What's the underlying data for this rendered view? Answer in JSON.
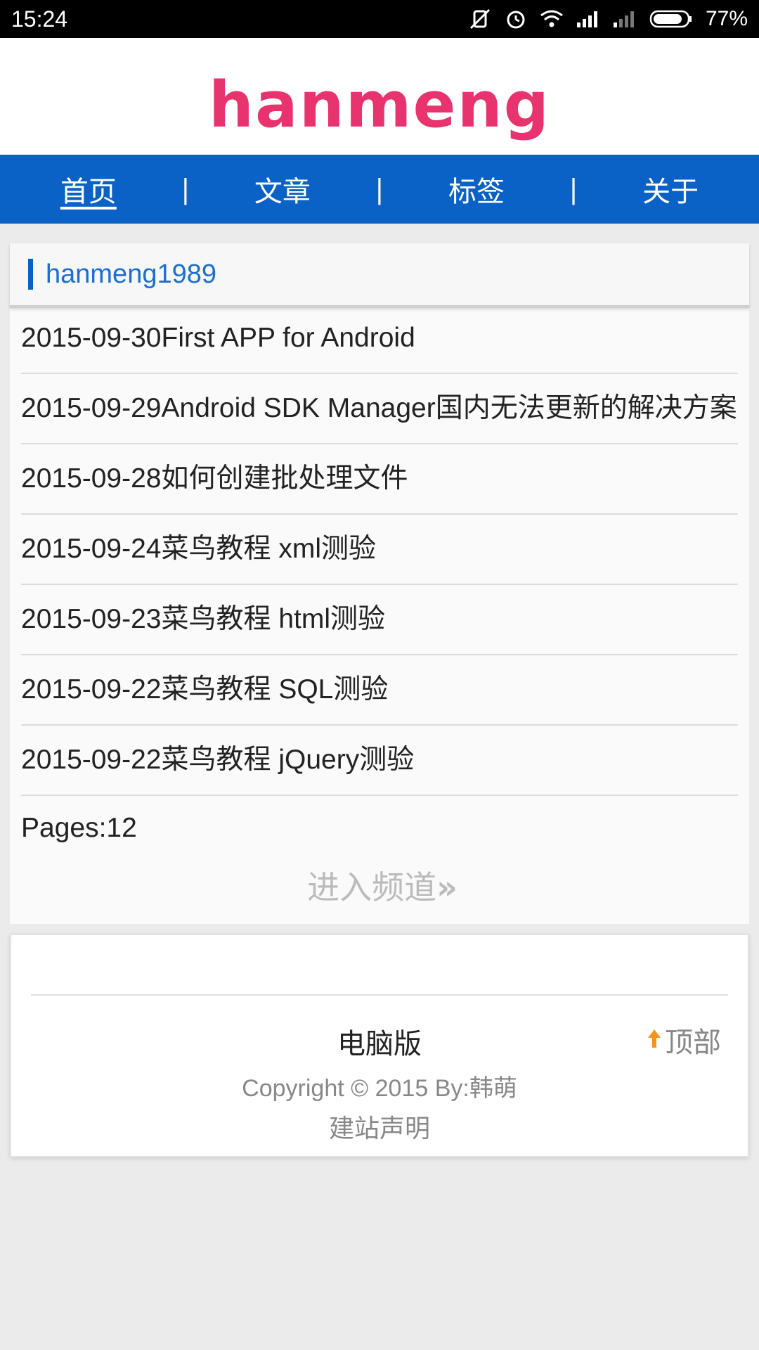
{
  "status_bar": {
    "time": "15:24",
    "battery": "77%",
    "icons": [
      "vibrate-off-icon",
      "alarm-icon",
      "wifi-icon",
      "signal-icon",
      "signal-weak-icon",
      "battery-icon"
    ]
  },
  "header": {
    "logo": "hanmeng"
  },
  "nav": {
    "items": [
      {
        "label": "首页"
      },
      {
        "label": "文章"
      },
      {
        "label": "标签"
      },
      {
        "label": "关于"
      }
    ],
    "separator": "|"
  },
  "panel": {
    "title": "hanmeng1989",
    "articles": [
      {
        "text": "2015-09-30First APP for Android"
      },
      {
        "text": "2015-09-29Android SDK Manager国内无法更新的解决方案"
      },
      {
        "text": "2015-09-28如何创建批处理文件"
      },
      {
        "text": "2015-09-24菜鸟教程 xml测验"
      },
      {
        "text": "2015-09-23菜鸟教程 html测验"
      },
      {
        "text": "2015-09-22菜鸟教程 SQL测验"
      },
      {
        "text": "2015-09-22菜鸟教程 jQuery测验"
      }
    ],
    "pages": "Pages:12",
    "channel_link": "进入频道",
    "channel_arrows": "»"
  },
  "footer": {
    "desktop_link": "电脑版",
    "top_link": "顶部",
    "copyright": "Copyright © 2015 By:韩萌",
    "statement": "建站声明"
  },
  "colors": {
    "nav_bg": "#0a62c7",
    "logo": "#e8336e",
    "accent_link": "#1a6fd0",
    "top_arrow": "#f7941d"
  }
}
